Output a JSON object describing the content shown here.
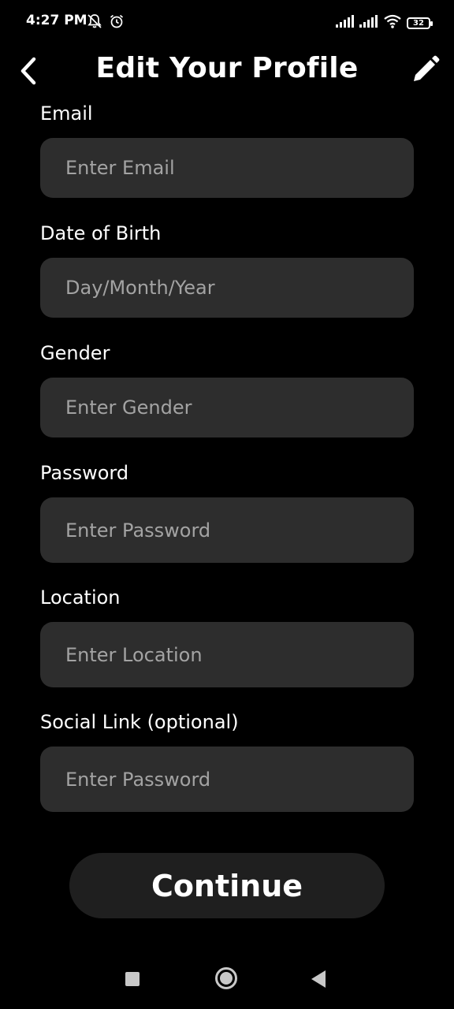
{
  "status_bar": {
    "time": "4:27 PM",
    "battery": "32",
    "icons": [
      "bell-off-icon",
      "alarm-icon",
      "signal-icon",
      "signal-icon",
      "wifi-icon",
      "battery-icon"
    ]
  },
  "header": {
    "title": "Edit Your Profile",
    "back_icon": "chevron-left-icon",
    "edit_icon": "pencil-icon"
  },
  "form": {
    "email": {
      "label": "Email",
      "placeholder": "Enter Email",
      "value": ""
    },
    "dob": {
      "label": "Date of Birth",
      "placeholder": "Day/Month/Year",
      "value": ""
    },
    "gender": {
      "label": "Gender",
      "placeholder": "Enter Gender",
      "value": ""
    },
    "password": {
      "label": "Password",
      "placeholder": "Enter Password",
      "value": ""
    },
    "location": {
      "label": "Location",
      "placeholder": "Enter Location",
      "value": ""
    },
    "social": {
      "label": "Social Link (optional)",
      "placeholder": "Enter Password",
      "value": ""
    }
  },
  "continue_label": "Continue",
  "nav": {
    "icons": [
      "recents-square-icon",
      "home-circle-icon",
      "back-triangle-icon"
    ]
  },
  "colors": {
    "background": "#000000",
    "input_background": "#2d2d2d",
    "placeholder": "#a3a3a3",
    "button_background": "#1f1f1f",
    "text": "#ffffff"
  }
}
